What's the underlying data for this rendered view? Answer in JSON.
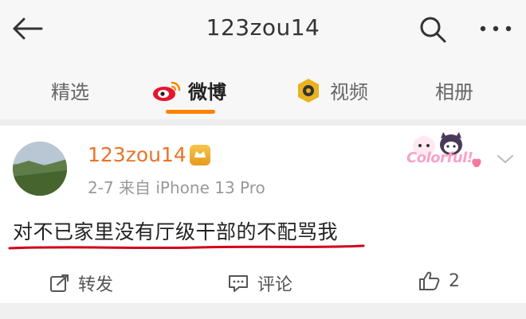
{
  "header": {
    "title": "123zou14"
  },
  "tabs": [
    {
      "label": "精选"
    },
    {
      "label": "微博"
    },
    {
      "label": "视频"
    },
    {
      "label": "相册"
    }
  ],
  "post": {
    "username": "123zou14",
    "meta": "2-7  来自 iPhone 13 Pro",
    "decor_text": "Colorful!",
    "text": "对不已家里没有厅级干部的不配骂我",
    "actions": {
      "repost": "转发",
      "comment": "评论",
      "like_count": "2"
    }
  },
  "colors": {
    "accent": "#ff8200",
    "username": "#e8742a",
    "underline_red": "#d0021b"
  }
}
